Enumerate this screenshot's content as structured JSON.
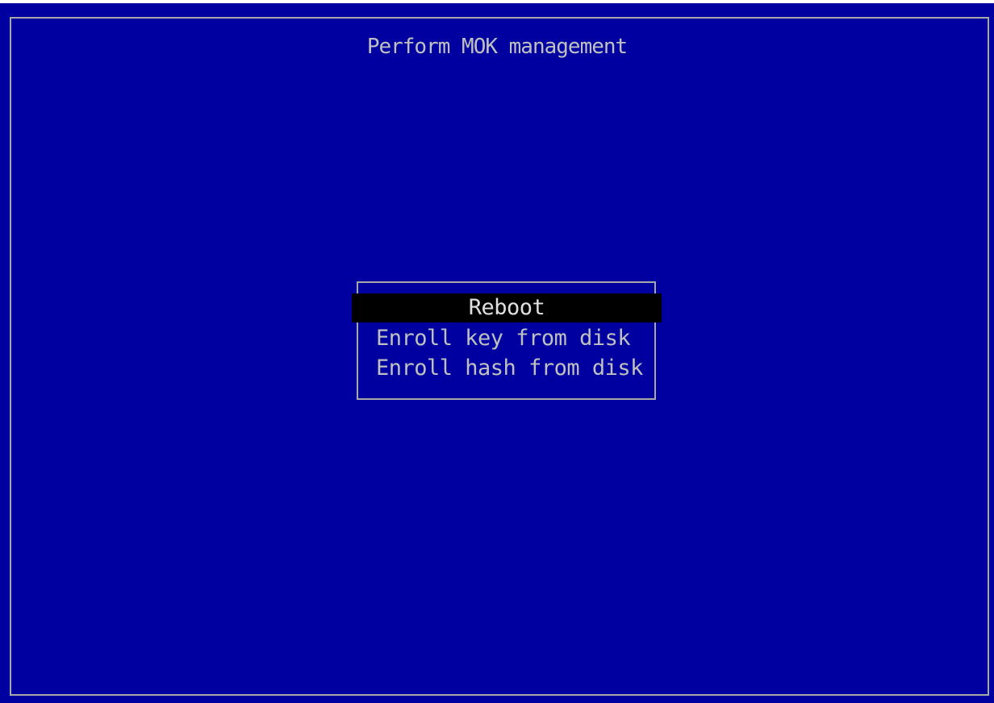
{
  "screen": {
    "title": "Perform MOK management",
    "background_color": "#0000a0",
    "text_color": "#c0c0c0",
    "border_color": "#a8a8a8",
    "selection_color": "#000000"
  },
  "menu": {
    "items": [
      {
        "label": "Reboot",
        "selected": true
      },
      {
        "label": "Enroll key from disk",
        "selected": false
      },
      {
        "label": "Enroll hash from disk",
        "selected": false
      }
    ]
  }
}
